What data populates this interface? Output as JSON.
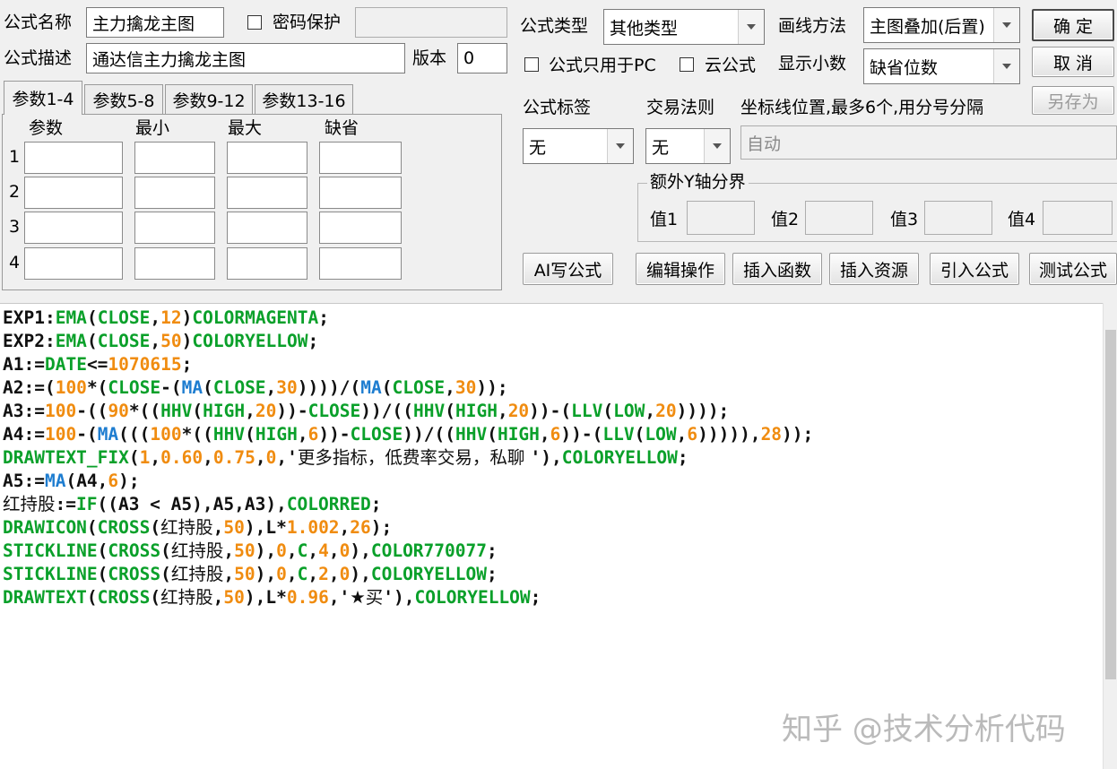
{
  "header": {
    "name_label": "公式名称",
    "name_value": "主力擒龙主图",
    "password_label": "密码保护",
    "desc_label": "公式描述",
    "desc_value": "通达信主力擒龙主图",
    "version_label": "版本",
    "version_value": "0"
  },
  "right_panel": {
    "type_label": "公式类型",
    "type_value": "其他类型",
    "draw_label": "画线方法",
    "draw_value": "主图叠加(后置)",
    "pc_only_label": "公式只用于PC",
    "cloud_label": "云公式",
    "decimals_label": "显示小数",
    "decimals_value": "缺省位数",
    "tag_label": "公式标签",
    "tag_value": "无",
    "trade_label": "交易法则",
    "trade_value": "无",
    "axis_label": "坐标线位置,最多6个,用分号分隔",
    "axis_placeholder": "自动",
    "yaxis_group_label": "额外Y轴分界",
    "v1": "值1",
    "v2": "值2",
    "v3": "值3",
    "v4": "值4"
  },
  "buttons": {
    "ok": "确 定",
    "cancel": "取 消",
    "save_as": "另存为",
    "ai": "AI写公式",
    "edit": "编辑操作",
    "insert_func": "插入函数",
    "insert_res": "插入资源",
    "import": "引入公式",
    "test": "测试公式"
  },
  "params": {
    "tabs": [
      "参数1-4",
      "参数5-8",
      "参数9-12",
      "参数13-16"
    ],
    "columns": [
      "参数",
      "最小",
      "最大",
      "缺省"
    ],
    "rows": [
      "1",
      "2",
      "3",
      "4"
    ]
  },
  "code_lines": [
    [
      [
        "EXP1:",
        "dark"
      ],
      [
        "EMA",
        "green"
      ],
      [
        "(",
        "dark"
      ],
      [
        "CLOSE",
        "green"
      ],
      [
        ",",
        "dark"
      ],
      [
        "12",
        "orange"
      ],
      [
        ")",
        "dark"
      ],
      [
        "COLORMAGENTA",
        "green"
      ],
      [
        ";",
        "dark"
      ]
    ],
    [
      [
        "EXP2:",
        "dark"
      ],
      [
        "EMA",
        "green"
      ],
      [
        "(",
        "dark"
      ],
      [
        "CLOSE",
        "green"
      ],
      [
        ",",
        "dark"
      ],
      [
        "50",
        "orange"
      ],
      [
        ")",
        "dark"
      ],
      [
        "COLORYELLOW",
        "green"
      ],
      [
        ";",
        "dark"
      ]
    ],
    [
      [
        "A1:=",
        "dark"
      ],
      [
        "DATE",
        "green"
      ],
      [
        "<=",
        "dark"
      ],
      [
        "1070615",
        "orange"
      ],
      [
        ";",
        "dark"
      ]
    ],
    [
      [
        "A2:=(",
        "dark"
      ],
      [
        "100",
        "orange"
      ],
      [
        "*(",
        "dark"
      ],
      [
        "CLOSE",
        "green"
      ],
      [
        "-(",
        "dark"
      ],
      [
        "MA",
        "blue"
      ],
      [
        "(",
        "dark"
      ],
      [
        "CLOSE",
        "green"
      ],
      [
        ",",
        "dark"
      ],
      [
        "30",
        "orange"
      ],
      [
        "))))/(",
        "dark"
      ],
      [
        "MA",
        "blue"
      ],
      [
        "(",
        "dark"
      ],
      [
        "CLOSE",
        "green"
      ],
      [
        ",",
        "dark"
      ],
      [
        "30",
        "orange"
      ],
      [
        "));",
        "dark"
      ]
    ],
    [
      [
        "A3:=",
        "dark"
      ],
      [
        "100",
        "orange"
      ],
      [
        "-((",
        "dark"
      ],
      [
        "90",
        "orange"
      ],
      [
        "*((",
        "dark"
      ],
      [
        "HHV",
        "green"
      ],
      [
        "(",
        "dark"
      ],
      [
        "HIGH",
        "green"
      ],
      [
        ",",
        "dark"
      ],
      [
        "20",
        "orange"
      ],
      [
        "))-",
        "dark"
      ],
      [
        "CLOSE",
        "green"
      ],
      [
        "))/((",
        "dark"
      ],
      [
        "HHV",
        "green"
      ],
      [
        "(",
        "dark"
      ],
      [
        "HIGH",
        "green"
      ],
      [
        ",",
        "dark"
      ],
      [
        "20",
        "orange"
      ],
      [
        "))-(",
        "dark"
      ],
      [
        "LLV",
        "green"
      ],
      [
        "(",
        "dark"
      ],
      [
        "LOW",
        "green"
      ],
      [
        ",",
        "dark"
      ],
      [
        "20",
        "orange"
      ],
      [
        "))));",
        "dark"
      ]
    ],
    [
      [
        "A4:=",
        "dark"
      ],
      [
        "100",
        "orange"
      ],
      [
        "-(",
        "dark"
      ],
      [
        "MA",
        "blue"
      ],
      [
        "(((",
        "dark"
      ],
      [
        "100",
        "orange"
      ],
      [
        "*((",
        "dark"
      ],
      [
        "HHV",
        "green"
      ],
      [
        "(",
        "dark"
      ],
      [
        "HIGH",
        "green"
      ],
      [
        ",",
        "dark"
      ],
      [
        "6",
        "orange"
      ],
      [
        "))-",
        "dark"
      ],
      [
        "CLOSE",
        "green"
      ],
      [
        "))/((",
        "dark"
      ],
      [
        "HHV",
        "green"
      ],
      [
        "(",
        "dark"
      ],
      [
        "HIGH",
        "green"
      ],
      [
        ",",
        "dark"
      ],
      [
        "6",
        "orange"
      ],
      [
        "))-(",
        "dark"
      ],
      [
        "LLV",
        "green"
      ],
      [
        "(",
        "dark"
      ],
      [
        "LOW",
        "green"
      ],
      [
        ",",
        "dark"
      ],
      [
        "6",
        "orange"
      ],
      [
        "))))),",
        "dark"
      ],
      [
        "28",
        "orange"
      ],
      [
        "));",
        "dark"
      ]
    ],
    [
      [
        "DRAWTEXT_FIX",
        "green"
      ],
      [
        "(",
        "dark"
      ],
      [
        "1",
        "orange"
      ],
      [
        ",",
        "dark"
      ],
      [
        "0.60",
        "orange"
      ],
      [
        ",",
        "dark"
      ],
      [
        "0.75",
        "orange"
      ],
      [
        ",",
        "dark"
      ],
      [
        "0",
        "orange"
      ],
      [
        ",'",
        "dark"
      ],
      [
        "更多指标，低费率交易，私聊 ",
        "cjk"
      ],
      [
        "'),",
        "dark"
      ],
      [
        "COLORYELLOW",
        "green"
      ],
      [
        ";",
        "dark"
      ]
    ],
    [
      [
        "A5:=",
        "dark"
      ],
      [
        "MA",
        "blue"
      ],
      [
        "(A4,",
        "dark"
      ],
      [
        "6",
        "orange"
      ],
      [
        ");",
        "dark"
      ]
    ],
    [
      [
        "红持股",
        "cjk"
      ],
      [
        ":=",
        "dark"
      ],
      [
        "IF",
        "green"
      ],
      [
        "((A3 < A5),A5,A3),",
        "dark"
      ],
      [
        "COLORRED",
        "green"
      ],
      [
        ";",
        "dark"
      ]
    ],
    [
      [
        "DRAWICON",
        "green"
      ],
      [
        "(",
        "dark"
      ],
      [
        "CROSS",
        "green"
      ],
      [
        "(",
        "dark"
      ],
      [
        "红持股",
        "cjk"
      ],
      [
        ",",
        "dark"
      ],
      [
        "50",
        "orange"
      ],
      [
        "),L*",
        "dark"
      ],
      [
        "1.002",
        "orange"
      ],
      [
        ",",
        "dark"
      ],
      [
        "26",
        "orange"
      ],
      [
        ");",
        "dark"
      ]
    ],
    [
      [
        "STICKLINE",
        "green"
      ],
      [
        "(",
        "dark"
      ],
      [
        "CROSS",
        "green"
      ],
      [
        "(",
        "dark"
      ],
      [
        "红持股",
        "cjk"
      ],
      [
        ",",
        "dark"
      ],
      [
        "50",
        "orange"
      ],
      [
        "),",
        "dark"
      ],
      [
        "0",
        "orange"
      ],
      [
        ",",
        "dark"
      ],
      [
        "C",
        "green"
      ],
      [
        ",",
        "dark"
      ],
      [
        "4",
        "orange"
      ],
      [
        ",",
        "dark"
      ],
      [
        "0",
        "orange"
      ],
      [
        "),",
        "dark"
      ],
      [
        "COLOR770077",
        "green"
      ],
      [
        ";",
        "dark"
      ]
    ],
    [
      [
        "STICKLINE",
        "green"
      ],
      [
        "(",
        "dark"
      ],
      [
        "CROSS",
        "green"
      ],
      [
        "(",
        "dark"
      ],
      [
        "红持股",
        "cjk"
      ],
      [
        ",",
        "dark"
      ],
      [
        "50",
        "orange"
      ],
      [
        "),",
        "dark"
      ],
      [
        "0",
        "orange"
      ],
      [
        ",",
        "dark"
      ],
      [
        "C",
        "green"
      ],
      [
        ",",
        "dark"
      ],
      [
        "2",
        "orange"
      ],
      [
        ",",
        "dark"
      ],
      [
        "0",
        "orange"
      ],
      [
        "),",
        "dark"
      ],
      [
        "COLORYELLOW",
        "green"
      ],
      [
        ";",
        "dark"
      ]
    ],
    [
      [
        "DRAWTEXT",
        "green"
      ],
      [
        "(",
        "dark"
      ],
      [
        "CROSS",
        "green"
      ],
      [
        "(",
        "dark"
      ],
      [
        "红持股",
        "cjk"
      ],
      [
        ",",
        "dark"
      ],
      [
        "50",
        "orange"
      ],
      [
        "),L*",
        "dark"
      ],
      [
        "0.96",
        "orange"
      ],
      [
        ",'",
        "dark"
      ],
      [
        "★买",
        "cjk"
      ],
      [
        "'),",
        "dark"
      ],
      [
        "COLORYELLOW",
        "green"
      ],
      [
        ";",
        "dark"
      ]
    ]
  ],
  "watermark": "知乎 @技术分析代码"
}
